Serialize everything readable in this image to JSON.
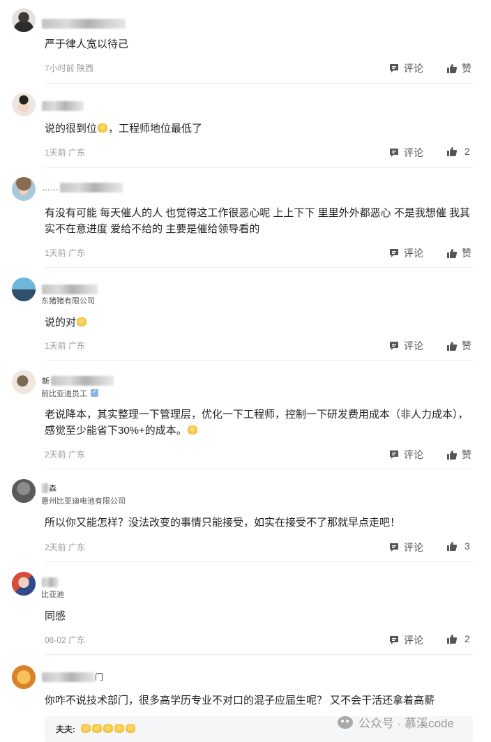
{
  "comments": [
    {
      "text": "严于律人宽以待己",
      "time": "7小时前",
      "location": "陕西",
      "reply_label": "评论",
      "like_label": "赞"
    },
    {
      "text_before": "说的很到位",
      "text_after": "，工程师地位最低了",
      "time": "1天前",
      "location": "广东",
      "reply_label": "评论",
      "like_label": "2"
    },
    {
      "name_prefix": "……",
      "text": "有没有可能 每天催人的人 也觉得这工作很恶心呢 上上下下 里里外外都恶心 不是我想催 我其实不在意进度 爱给不给的 主要是催给领导看的",
      "time": "1天前",
      "location": "广东",
      "reply_label": "评论",
      "like_label": "赞"
    },
    {
      "subtitle": "东猪猪有限公司",
      "text_before": "说的对",
      "time": "1天前",
      "location": "广东",
      "reply_label": "评论",
      "like_label": "赞"
    },
    {
      "name_prefix": "新",
      "subtitle": "前比亚迪员工",
      "text_before": "老说降本，其实整理一下管理层，优化一下工程师，控制一下研发费用成本（非人力成本），感觉至少能省下30%+的成本。",
      "time": "2天前",
      "location": "广东",
      "reply_label": "评论",
      "like_label": "赞"
    },
    {
      "name_prefix": "森",
      "subtitle": "惠州比亚迪电池有限公司",
      "text": "所以你又能怎样？没法改变的事情只能接受，如实在接受不了那就早点走吧！",
      "time": "2天前",
      "location": "广东",
      "reply_label": "评论",
      "like_label": "3"
    },
    {
      "subtitle": "比亚迪",
      "text": "同感",
      "time": "08-02",
      "location": "广东",
      "reply_label": "评论",
      "like_label": "2"
    },
    {
      "name_suffix": "门",
      "text": "你咋不说技术部门，很多高学历专业不对口的混子应届生呢？ 又不会干活还拿着高薪"
    }
  ],
  "quote": {
    "label": "夫夫:"
  },
  "watermark": {
    "text": "公众号 · 慕溪code"
  },
  "colors": {
    "meta": "#9a9a9a",
    "action": "#555555",
    "emoji": "#f4c542"
  }
}
